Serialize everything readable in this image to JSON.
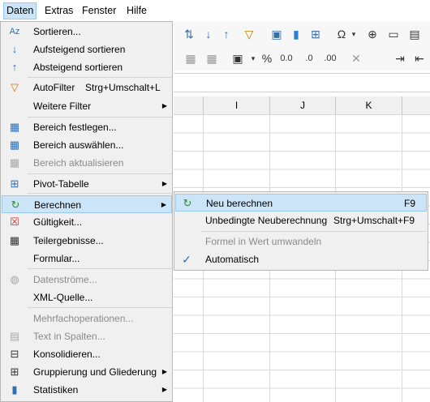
{
  "menubar": {
    "items": [
      {
        "label": "Daten",
        "active": true
      },
      {
        "label": "Extras"
      },
      {
        "label": "Fenster"
      },
      {
        "label": "Hilfe"
      }
    ]
  },
  "sheet": {
    "columns": [
      "I",
      "J",
      "K"
    ]
  },
  "menu": {
    "items": [
      {
        "label": "Sortieren...",
        "icon": "sort-icon"
      },
      {
        "label": "Aufsteigend sortieren",
        "icon": "sort-ascending-icon"
      },
      {
        "label": "Absteigend sortieren",
        "icon": "sort-descending-icon"
      },
      {
        "label": "AutoFilter",
        "shortcut": "Strg+Umschalt+L",
        "icon": "autofilter-icon"
      },
      {
        "label": "Weitere Filter",
        "submenu": true
      },
      {
        "label": "Bereich festlegen...",
        "icon": "define-range-icon"
      },
      {
        "label": "Bereich auswählen...",
        "icon": "select-range-icon"
      },
      {
        "label": "Bereich aktualisieren",
        "icon": "refresh-range-icon",
        "disabled": true
      },
      {
        "label": "Pivot-Tabelle",
        "icon": "pivot-table-icon",
        "submenu": true
      },
      {
        "label": "Berechnen",
        "icon": "calculate-icon",
        "submenu": true,
        "highlighted": true
      },
      {
        "label": "Gültigkeit...",
        "icon": "validity-icon"
      },
      {
        "label": "Teilergebnisse...",
        "icon": "subtotals-icon"
      },
      {
        "label": "Formular..."
      },
      {
        "label": "Datenströme...",
        "icon": "datastreams-icon",
        "disabled": true
      },
      {
        "label": "XML-Quelle..."
      },
      {
        "label": "Mehrfachoperationen...",
        "disabled": true
      },
      {
        "label": "Text in Spalten...",
        "icon": "text-to-columns-icon",
        "disabled": true
      },
      {
        "label": "Konsolidieren...",
        "icon": "consolidate-icon"
      },
      {
        "label": "Gruppierung und Gliederung",
        "icon": "group-outline-icon",
        "submenu": true
      },
      {
        "label": "Statistiken",
        "icon": "statistics-icon",
        "submenu": true
      }
    ]
  },
  "submenu": {
    "items": [
      {
        "label": "Neu berechnen",
        "shortcut": "F9",
        "icon": "recalculate-icon",
        "highlighted": true
      },
      {
        "label": "Unbedingte Neuberechnung",
        "shortcut": "Strg+Umschalt+F9"
      },
      {
        "label": "Formel in Wert umwandeln",
        "disabled": true
      },
      {
        "label": "Automatisch",
        "icon": "checkmark-icon",
        "checked": true
      }
    ]
  }
}
